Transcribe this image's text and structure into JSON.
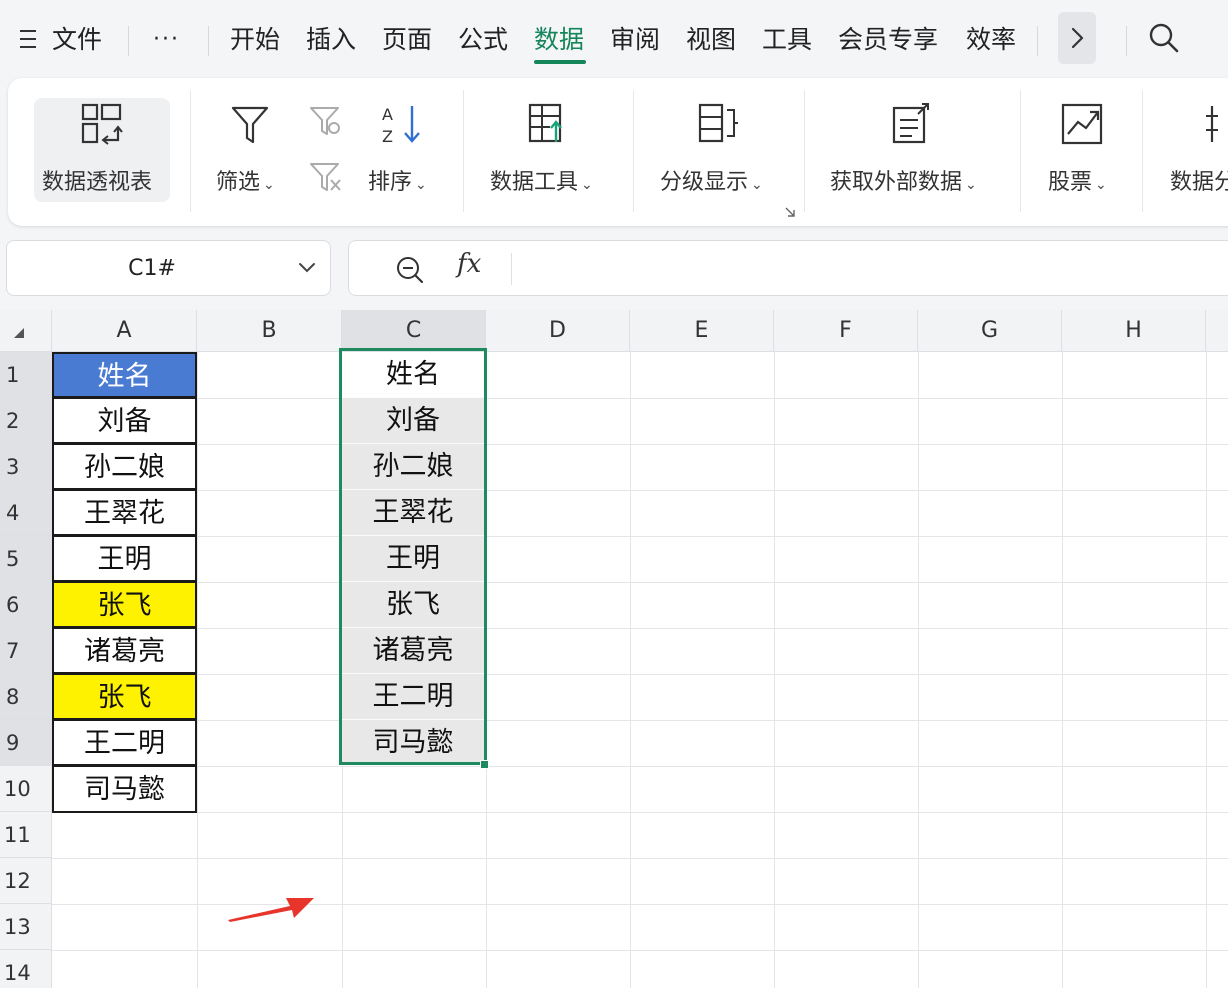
{
  "menu": {
    "file": "文件",
    "more": "···",
    "tabs": [
      "开始",
      "插入",
      "页面",
      "公式",
      "数据",
      "审阅",
      "视图",
      "工具",
      "会员专享",
      "效率"
    ],
    "active_tab": "数据"
  },
  "ribbon": {
    "pivot": "数据透视表",
    "filter": "筛选",
    "sort": "排序",
    "data_tools": "数据工具",
    "outline": "分级显示",
    "external": "获取外部数据",
    "stocks": "股票",
    "data_partial": "数据分"
  },
  "name_box": {
    "value": "C1#"
  },
  "formula_bar": {
    "fx": "fx"
  },
  "columns": [
    "A",
    "B",
    "C",
    "D",
    "E",
    "F",
    "G",
    "H"
  ],
  "rows": [
    "1",
    "2",
    "3",
    "4",
    "5",
    "6",
    "7",
    "8",
    "9",
    "10",
    "11",
    "12",
    "13",
    "14"
  ],
  "col_a": [
    "姓名",
    "刘备",
    "孙二娘",
    "王翠花",
    "王明",
    "张飞",
    "诸葛亮",
    "张飞",
    "王二明",
    "司马懿"
  ],
  "col_c": [
    "姓名",
    "刘备",
    "孙二娘",
    "王翠花",
    "王明",
    "张飞",
    "诸葛亮",
    "王二明",
    "司马懿"
  ],
  "colors": {
    "accent": "#15855a",
    "header_fill": "#4a7bd3",
    "highlight": "#fff200",
    "selection": "#1f8a5f",
    "arrow": "#e8352c"
  }
}
